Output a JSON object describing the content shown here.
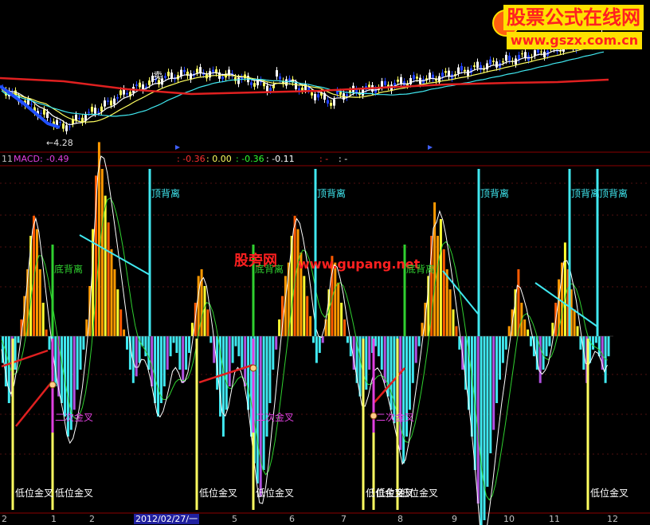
{
  "logo": {
    "title": "股票公式在线网",
    "url": "www.gszx.com.cn",
    "title_color": "#ff2020",
    "bg_color": "#ffe000"
  },
  "watermark": {
    "cn": "股旁网",
    "url": "www.gupang.net",
    "color": "#ff2020"
  },
  "price_panel": {
    "low_label": "4.28",
    "signal_label": "卖"
  },
  "macd_header": {
    "prefix": "11",
    "name": "MACD:",
    "value": "-0.49",
    "items": [
      {
        "text": ": -0.36",
        "color": "#ff3030"
      },
      {
        "text": ": 0.00",
        "color": "#ffff60"
      },
      {
        "text": ": -0.36",
        "color": "#30ff30"
      },
      {
        "text": ": -0.11",
        "color": "#ffffff"
      },
      {
        "text": ": -",
        "color": "#ff3030"
      },
      {
        "text": ": -",
        "color": "#ffffff"
      }
    ]
  },
  "x_axis": {
    "ticks": [
      "2",
      "1",
      "2",
      "2012/02/27/一",
      "5",
      "6",
      "7",
      "8",
      "9",
      "10",
      "11",
      "12"
    ],
    "highlight": "2012/02/27/一"
  },
  "annotations": {
    "top_div": "顶背离",
    "bottom_div": "底背离",
    "second_cross": "二次金叉",
    "low_cross": "低位金叉"
  },
  "colors": {
    "top_div": "#40e8f0",
    "bottom_div": "#30d030",
    "second_cross": "#e040e0",
    "low_cross": "#ffff60",
    "bar_pos": "#ff9900",
    "bar_neg": "#40e8f0",
    "dif": "#ffffff",
    "dea": "#30d030",
    "red_link": "#e02020"
  },
  "chart_data": {
    "type": "bar",
    "title": "",
    "series": [
      {
        "values": [
          -0.08,
          -0.15,
          -0.2,
          -0.18,
          -0.1,
          -0.02,
          0.05,
          0.12,
          0.2,
          0.3,
          0.36,
          0.32,
          0.2,
          0.1,
          0.02,
          -0.04,
          -0.1,
          -0.15,
          -0.18,
          -0.2,
          -0.24,
          -0.3,
          -0.28,
          -0.22,
          -0.16,
          -0.1,
          -0.04,
          0.05,
          0.15,
          0.32,
          0.48,
          0.58,
          0.5,
          0.42,
          0.34,
          0.26,
          0.2,
          0.14,
          0.08,
          0.02,
          -0.04,
          -0.1,
          -0.14,
          -0.12,
          -0.08,
          -0.03,
          -0.06,
          -0.1,
          -0.15,
          -0.2,
          -0.24,
          -0.2,
          -0.15,
          -0.1,
          -0.06,
          -0.02,
          -0.05,
          -0.1,
          -0.14,
          -0.1,
          -0.05,
          0.04,
          0.1,
          0.18,
          0.2,
          0.15,
          0.08,
          -0.02,
          -0.08,
          -0.16,
          -0.24,
          -0.3,
          -0.22,
          -0.15,
          -0.08,
          -0.03,
          -0.06,
          -0.1,
          -0.15,
          -0.22,
          -0.3,
          -0.38,
          -0.44,
          -0.48,
          -0.4,
          -0.3,
          -0.2,
          -0.1,
          -0.04,
          0.05,
          0.12,
          0.18,
          0.22,
          0.3,
          0.36,
          0.32,
          0.25,
          0.18,
          0.12,
          0.06,
          -0.02,
          -0.08,
          -0.05,
          -0.02,
          0.05,
          0.14,
          0.24,
          0.22,
          0.16,
          0.1,
          0.05,
          -0.02,
          -0.06,
          -0.1,
          -0.14,
          -0.18,
          -0.22,
          -0.16,
          -0.1,
          -0.05,
          -0.03,
          -0.06,
          -0.1,
          -0.14,
          -0.18,
          -0.22,
          -0.26,
          -0.3,
          -0.34,
          -0.38,
          -0.3,
          -0.22,
          -0.14,
          -0.08,
          -0.03,
          0.04,
          0.1,
          0.18,
          0.3,
          0.4,
          0.3,
          0.35,
          0.26,
          0.2,
          0.14,
          0.08,
          0.03,
          -0.04,
          -0.1,
          -0.16,
          -0.22,
          -0.3,
          -0.4,
          -0.5,
          -0.6,
          -0.55,
          -0.45,
          -0.35,
          -0.28,
          -0.2,
          -0.13,
          -0.08,
          -0.04,
          0.03,
          0.08,
          0.14,
          0.2,
          0.1,
          0.05,
          0.02,
          -0.03,
          -0.06,
          -0.1,
          -0.14,
          -0.1,
          -0.06,
          -0.03,
          0.04,
          0.1,
          0.17,
          0.22,
          0.28,
          0.2,
          0.14,
          0.08,
          0.03,
          -0.04,
          -0.1,
          -0.14,
          -0.08,
          -0.04,
          -0.02,
          -0.06,
          -0.1,
          -0.14,
          -0.06
        ],
        "color": "#ff9900"
      }
    ],
    "markers": {
      "top_divergence": [
        188,
        396,
        601,
        715,
        750
      ],
      "bottom_divergence": [
        66,
        318,
        508
      ],
      "second_cross": [
        66,
        318,
        469
      ],
      "low_cross": [
        16,
        66,
        247,
        318,
        456,
        469,
        499,
        738
      ]
    }
  }
}
